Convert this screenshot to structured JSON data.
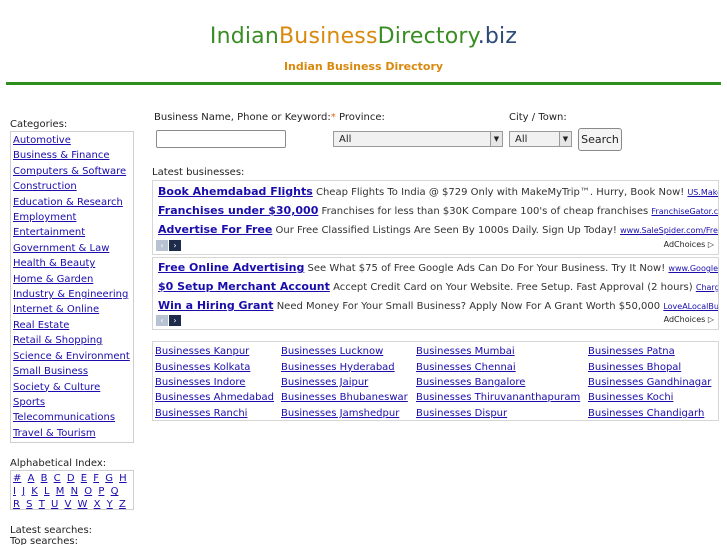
{
  "header": {
    "logo_part1": "Indian",
    "logo_part2": "Business",
    "logo_part3": "Directory",
    "logo_part4": ".biz",
    "tagline": "Indian Business Directory"
  },
  "sidebar": {
    "categories_label": "Categories:",
    "categories": [
      "Automotive",
      "Business & Finance",
      "Computers & Software",
      "Construction",
      "Education & Research",
      "Employment",
      "Entertainment",
      "Government & Law",
      "Health & Beauty",
      "Home & Garden",
      "Industry & Engineering",
      "Internet & Online",
      "Real Estate",
      "Retail & Shopping",
      "Science & Environment",
      "Small Business",
      "Society & Culture",
      "Sports",
      "Telecommunications",
      "Travel & Tourism"
    ],
    "alpha_label": "Alphabetical Index:",
    "alpha": [
      "#",
      "A",
      "B",
      "C",
      "D",
      "E",
      "F",
      "G",
      "H",
      "I",
      "J",
      "K",
      "L",
      "M",
      "N",
      "O",
      "P",
      "Q",
      "R",
      "S",
      "T",
      "U",
      "V",
      "W",
      "X",
      "Y",
      "Z"
    ],
    "latest_searches_label": "Latest searches:",
    "top_searches_label": "Top searches:"
  },
  "search": {
    "keyword_label": "Business Name, Phone or Keyword:",
    "required_mark": "*",
    "province_label": "Province:",
    "city_label": "City / Town:",
    "keyword_value": "",
    "province_value": "All",
    "city_value": "All",
    "button_label": "Search"
  },
  "latest_businesses_label": "Latest businesses:",
  "ad_blocks": [
    {
      "ads": [
        {
          "title": "Book Ahemdabad Flights",
          "desc": "Cheap Flights To India @ $729 Only with MakeMyTrip™. Hurry, Book Now!",
          "url": "US.MakeMyTrip.com"
        },
        {
          "title": "Franchises under $30,000",
          "desc": "Franchises for less than $30K Compare 100's of cheap franchises",
          "url": "FranchiseGator.com"
        },
        {
          "title": "Advertise For Free",
          "desc": "Our Free Classified Listings Are Seen By 1000s Daily. Sign Up Today!",
          "url": "www.SaleSpider.com/FreeClassifieds"
        }
      ],
      "adchoices": "AdChoices"
    },
    {
      "ads": [
        {
          "title": "Free Online Advertising",
          "desc": "See What $75 of Free Google Ads Can Do For Your Business. Try It Now!",
          "url": "www.Google.com/AdWords"
        },
        {
          "title": "$0 Setup Merchant Account",
          "desc": "Accept Credit Card on Your Website. Free Setup. Fast Approval (2 hours)",
          "url": "Charge-It-Pro.com"
        },
        {
          "title": "Win a Hiring Grant",
          "desc": "Need Money For Your Small Business? Apply Now For A Grant Worth $50,000",
          "url": "LoveALocalBusiness.com"
        }
      ],
      "adchoices": "AdChoices"
    }
  ],
  "city_links": [
    [
      "Businesses Kanpur",
      "Businesses Lucknow",
      "Businesses Mumbai",
      "Businesses Patna"
    ],
    [
      "Businesses Kolkata",
      "Businesses Hyderabad",
      "Businesses Chennai",
      "Businesses Bhopal"
    ],
    [
      "Businesses Indore",
      "Businesses Jaipur",
      "Businesses Bangalore",
      "Businesses Gandhinagar"
    ],
    [
      "Businesses Ahmedabad",
      "Businesses Bhubaneswar",
      "Businesses Thiruvananthapuram",
      "Businesses Kochi"
    ],
    [
      "Businesses Ranchi",
      "Businesses Jamshedpur",
      "Businesses Dispur",
      "Businesses Chandigarh"
    ]
  ]
}
